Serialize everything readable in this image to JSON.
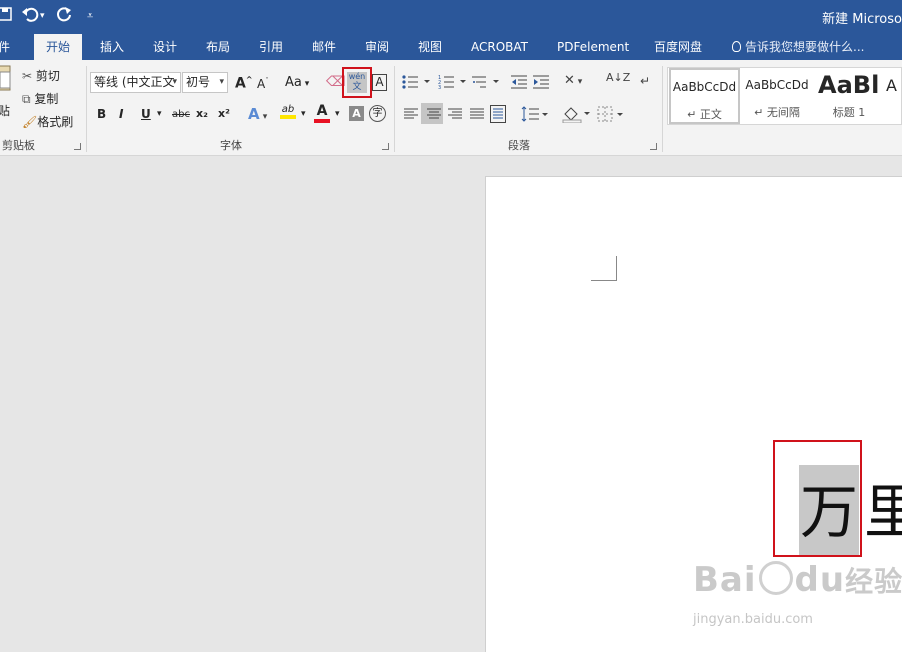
{
  "titlebar": {
    "save_icon": "save-icon",
    "undo_icon": "undo-icon",
    "redo_icon": "redo-icon",
    "customize_icon": "customize-quick-access-icon",
    "doc_title": "新建 Microso"
  },
  "tabs": [
    {
      "label": "件"
    },
    {
      "label": "开始",
      "active": true
    },
    {
      "label": "插入"
    },
    {
      "label": "设计"
    },
    {
      "label": "布局"
    },
    {
      "label": "引用"
    },
    {
      "label": "邮件"
    },
    {
      "label": "审阅"
    },
    {
      "label": "视图"
    },
    {
      "label": "ACROBAT"
    },
    {
      "label": "PDFelement"
    },
    {
      "label": "百度网盘"
    }
  ],
  "tellme": {
    "icon": "lightbulb-icon",
    "text": "告诉我您想要做什么..."
  },
  "clipboard": {
    "paste_label": "贴",
    "cut_label": "剪切",
    "copy_label": "复制",
    "format_painter_label": "格式刷",
    "group_label": "剪贴板"
  },
  "font": {
    "font_name": "等线 (中文正文",
    "font_size": "初号",
    "grow_label": "A",
    "shrink_label": "A",
    "case_label": "Aa",
    "phonetic_top": "wén",
    "phonetic_bottom": "文",
    "border_label": "A",
    "bold": "B",
    "italic": "I",
    "underline": "U",
    "strike": "abc",
    "sub": "x₂",
    "sup": "x²",
    "effects_label": "A",
    "highlight_label": "ab",
    "color_label": "A",
    "shade_label": "A",
    "enclose_label": "字",
    "group_label": "字体",
    "highlight_color": "#ffe600",
    "font_color": "#e81123"
  },
  "paragraph": {
    "group_label": "段落",
    "sort_label": "A↓Z"
  },
  "styles": [
    {
      "preview": "AaBbCcDd",
      "name": "↵ 正文",
      "selected": true
    },
    {
      "preview": "AaBbCcDd",
      "name": "↵ 无间隔"
    },
    {
      "preview": "AaBl",
      "name": "标题 1"
    },
    {
      "preview": "A",
      "name": ""
    }
  ],
  "document": {
    "char_selected": "万",
    "char_next": "里"
  },
  "watermark": {
    "main": "Bai",
    "main2": "du",
    "main3": "经验",
    "sub": "jingyan.baidu.com"
  }
}
